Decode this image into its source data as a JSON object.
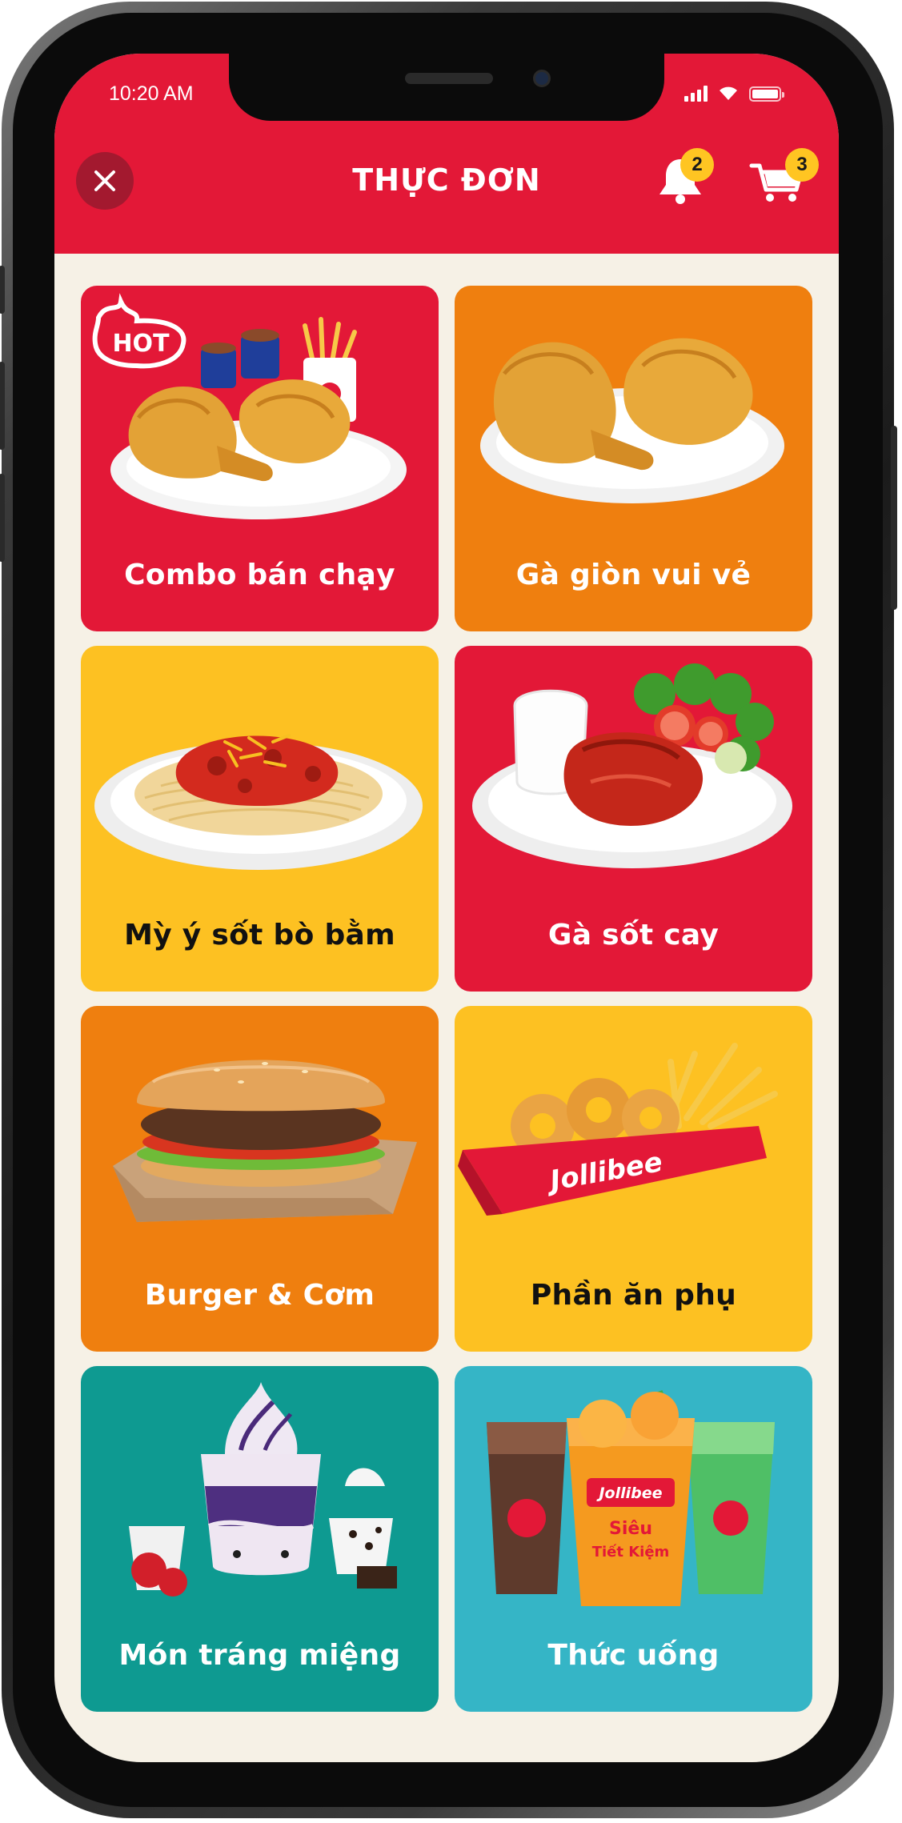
{
  "status_bar": {
    "time": "10:20 AM"
  },
  "header": {
    "title": "THỰC ĐƠN",
    "notifications_count": "2",
    "cart_count": "3"
  },
  "colors": {
    "brand_red": "#e31837",
    "orange": "#ef7f0f",
    "yellow": "#fdc122",
    "teal": "#0e9a91",
    "cyan": "#35b5c6",
    "badge": "#ffc522"
  },
  "menu": {
    "hot_badge": "HOT",
    "categories": [
      {
        "label": "Combo bán chạy",
        "color": "red",
        "icon": "fried-chicken-combo-icon"
      },
      {
        "label": "Gà giòn vui vẻ",
        "color": "orange",
        "icon": "fried-chicken-icon"
      },
      {
        "label": "Mỳ ý sốt bò bằm",
        "color": "yellow",
        "icon": "spaghetti-icon"
      },
      {
        "label": "Gà sốt cay",
        "color": "red",
        "icon": "spicy-chicken-icon"
      },
      {
        "label": "Burger & Cơm",
        "color": "orange",
        "icon": "burger-icon"
      },
      {
        "label": "Phần ăn phụ",
        "color": "yellow",
        "icon": "fries-icon"
      },
      {
        "label": "Món tráng miệng",
        "color": "teal",
        "icon": "dessert-icon"
      },
      {
        "label": "Thức uống",
        "color": "cyan",
        "icon": "drinks-icon"
      }
    ]
  },
  "product_print": {
    "brand": "Jollibee",
    "drink_promo_line1": "Siêu",
    "drink_promo_line2": "Tiết Kiệm"
  }
}
